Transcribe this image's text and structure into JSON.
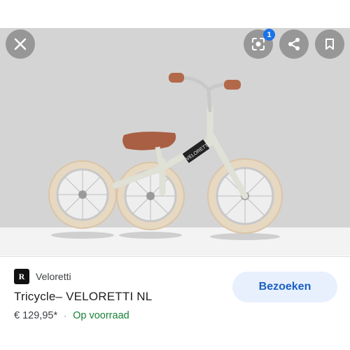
{
  "toolbar": {
    "close_icon": "close-icon",
    "lens_icon": "lens-icon",
    "lens_badge": "1",
    "share_icon": "share-icon",
    "save_icon": "bookmark-icon"
  },
  "result": {
    "source_logo_letter": "R",
    "source_name": "Veloretti",
    "title": "Tricycle– VELORETTI NL",
    "price": "€ 129,95*",
    "separator": "·",
    "availability": "Op voorraad",
    "visit_button": "Bezoeken"
  },
  "product_image": {
    "frame_text": "VELORETTI"
  },
  "colors": {
    "availability": "#188038",
    "visit_button_bg": "#e8f0fe",
    "visit_button_text": "#1a5fc0",
    "badge": "#1a73e8"
  }
}
